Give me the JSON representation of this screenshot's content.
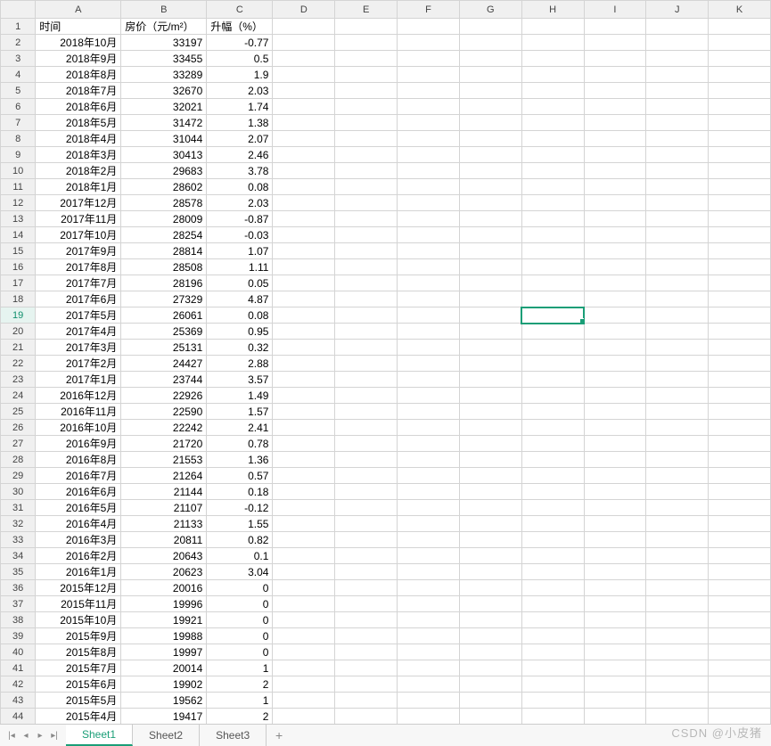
{
  "columns": [
    "A",
    "B",
    "C",
    "D",
    "E",
    "F",
    "G",
    "H",
    "I",
    "J",
    "K"
  ],
  "headers": {
    "A": "时间",
    "B": "房价（元/m²）",
    "C": "升幅（%）"
  },
  "rows": [
    {
      "n": 1,
      "a": "",
      "b": "",
      "c": ""
    },
    {
      "n": 2,
      "a": "2018年10月",
      "b": "33197",
      "c": "-0.77"
    },
    {
      "n": 3,
      "a": "2018年9月",
      "b": "33455",
      "c": "0.5"
    },
    {
      "n": 4,
      "a": "2018年8月",
      "b": "33289",
      "c": "1.9"
    },
    {
      "n": 5,
      "a": "2018年7月",
      "b": "32670",
      "c": "2.03"
    },
    {
      "n": 6,
      "a": "2018年6月",
      "b": "32021",
      "c": "1.74"
    },
    {
      "n": 7,
      "a": "2018年5月",
      "b": "31472",
      "c": "1.38"
    },
    {
      "n": 8,
      "a": "2018年4月",
      "b": "31044",
      "c": "2.07"
    },
    {
      "n": 9,
      "a": "2018年3月",
      "b": "30413",
      "c": "2.46"
    },
    {
      "n": 10,
      "a": "2018年2月",
      "b": "29683",
      "c": "3.78"
    },
    {
      "n": 11,
      "a": "2018年1月",
      "b": "28602",
      "c": "0.08"
    },
    {
      "n": 12,
      "a": "2017年12月",
      "b": "28578",
      "c": "2.03"
    },
    {
      "n": 13,
      "a": "2017年11月",
      "b": "28009",
      "c": "-0.87"
    },
    {
      "n": 14,
      "a": "2017年10月",
      "b": "28254",
      "c": "-0.03"
    },
    {
      "n": 15,
      "a": "2017年9月",
      "b": "28814",
      "c": "1.07"
    },
    {
      "n": 16,
      "a": "2017年8月",
      "b": "28508",
      "c": "1.11"
    },
    {
      "n": 17,
      "a": "2017年7月",
      "b": "28196",
      "c": "0.05"
    },
    {
      "n": 18,
      "a": "2017年6月",
      "b": "27329",
      "c": "4.87"
    },
    {
      "n": 19,
      "a": "2017年5月",
      "b": "26061",
      "c": "0.08"
    },
    {
      "n": 20,
      "a": "2017年4月",
      "b": "25369",
      "c": "0.95"
    },
    {
      "n": 21,
      "a": "2017年3月",
      "b": "25131",
      "c": "0.32"
    },
    {
      "n": 22,
      "a": "2017年2月",
      "b": "24427",
      "c": "2.88"
    },
    {
      "n": 23,
      "a": "2017年1月",
      "b": "23744",
      "c": "3.57"
    },
    {
      "n": 24,
      "a": "2016年12月",
      "b": "22926",
      "c": "1.49"
    },
    {
      "n": 25,
      "a": "2016年11月",
      "b": "22590",
      "c": "1.57"
    },
    {
      "n": 26,
      "a": "2016年10月",
      "b": "22242",
      "c": "2.41"
    },
    {
      "n": 27,
      "a": "2016年9月",
      "b": "21720",
      "c": "0.78"
    },
    {
      "n": 28,
      "a": "2016年8月",
      "b": "21553",
      "c": "1.36"
    },
    {
      "n": 29,
      "a": "2016年7月",
      "b": "21264",
      "c": "0.57"
    },
    {
      "n": 30,
      "a": "2016年6月",
      "b": "21144",
      "c": "0.18"
    },
    {
      "n": 31,
      "a": "2016年5月",
      "b": "21107",
      "c": "-0.12"
    },
    {
      "n": 32,
      "a": "2016年4月",
      "b": "21133",
      "c": "1.55"
    },
    {
      "n": 33,
      "a": "2016年3月",
      "b": "20811",
      "c": "0.82"
    },
    {
      "n": 34,
      "a": "2016年2月",
      "b": "20643",
      "c": "0.1"
    },
    {
      "n": 35,
      "a": "2016年1月",
      "b": "20623",
      "c": "3.04"
    },
    {
      "n": 36,
      "a": "2015年12月",
      "b": "20016",
      "c": "0"
    },
    {
      "n": 37,
      "a": "2015年11月",
      "b": "19996",
      "c": "0"
    },
    {
      "n": 38,
      "a": "2015年10月",
      "b": "19921",
      "c": "0"
    },
    {
      "n": 39,
      "a": "2015年9月",
      "b": "19988",
      "c": "0"
    },
    {
      "n": 40,
      "a": "2015年8月",
      "b": "19997",
      "c": "0"
    },
    {
      "n": 41,
      "a": "2015年7月",
      "b": "20014",
      "c": "1"
    },
    {
      "n": 42,
      "a": "2015年6月",
      "b": "19902",
      "c": "2"
    },
    {
      "n": 43,
      "a": "2015年5月",
      "b": "19562",
      "c": "1"
    },
    {
      "n": 44,
      "a": "2015年4月",
      "b": "19417",
      "c": "2"
    }
  ],
  "activeRow": 19,
  "selectedCell": {
    "row": 19,
    "col": "H"
  },
  "tabs": {
    "items": [
      "Sheet1",
      "Sheet2",
      "Sheet3"
    ],
    "active": 0
  },
  "nav": {
    "first": "|◂",
    "prev": "◂",
    "next": "▸",
    "last": "▸|"
  },
  "addTab": "+",
  "watermark": "CSDN @小皮猪"
}
